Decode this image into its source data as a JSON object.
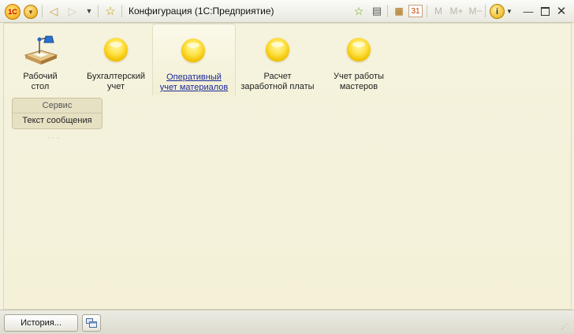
{
  "window": {
    "title": "Конфигурация  (1С:Предприятие)",
    "logo_text": "1С"
  },
  "toolbar": {
    "icons": [
      "logo-1c-icon",
      "main-menu-icon",
      "back-arrow-icon",
      "forward-arrow-icon",
      "navigation-dropdown-icon",
      "favorites-star-icon",
      "add-to-favorites-icon",
      "history-list-icon",
      "calculator-icon",
      "calendar-icon",
      "info-icon"
    ],
    "calendar_day": "31",
    "memory_buttons": [
      "M",
      "M+",
      "M−"
    ]
  },
  "sections": [
    {
      "label": "Рабочий\nстол",
      "icon": "desk-lamp-icon",
      "active": false
    },
    {
      "label": "Бухгалтерский\nучет",
      "icon": "yellow-ball-icon",
      "active": false
    },
    {
      "label": "Оперативный\nучет материалов",
      "icon": "yellow-ball-icon",
      "active": true
    },
    {
      "label": "Расчет\nзаработной платы",
      "icon": "yellow-ball-icon",
      "active": false
    },
    {
      "label": "Учет работы\nмастеров",
      "icon": "yellow-ball-icon",
      "active": false
    }
  ],
  "service_panel": {
    "title": "Сервис",
    "items": [
      "Текст сообщения"
    ]
  },
  "statusbar": {
    "history_label": "История..."
  },
  "colors": {
    "background": "#f4f2dc",
    "active_link": "#1a2a9a",
    "ball": "#ffe24a"
  }
}
